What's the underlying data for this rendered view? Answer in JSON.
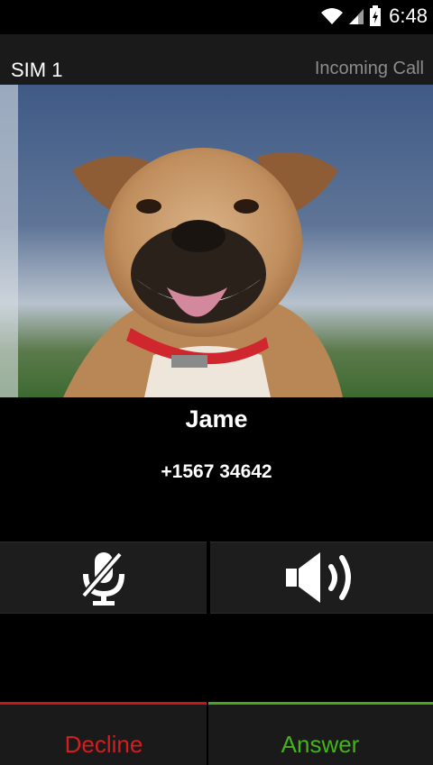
{
  "status_bar": {
    "time": "6:48",
    "icons": [
      "wifi-icon",
      "signal-icon",
      "battery-icon"
    ]
  },
  "header": {
    "sim_label": "SIM 1",
    "call_state": "Incoming Call"
  },
  "caller": {
    "name": "Jame",
    "number": "+1567 34642",
    "photo": "dog-photo"
  },
  "controls": {
    "mute_icon": "microphone-muted-icon",
    "speaker_icon": "speaker-icon"
  },
  "actions": {
    "decline_label": "Decline",
    "answer_label": "Answer"
  },
  "colors": {
    "decline": "#d21e1e",
    "answer": "#43b318",
    "background": "#000000",
    "panel": "#1a1a1a"
  }
}
